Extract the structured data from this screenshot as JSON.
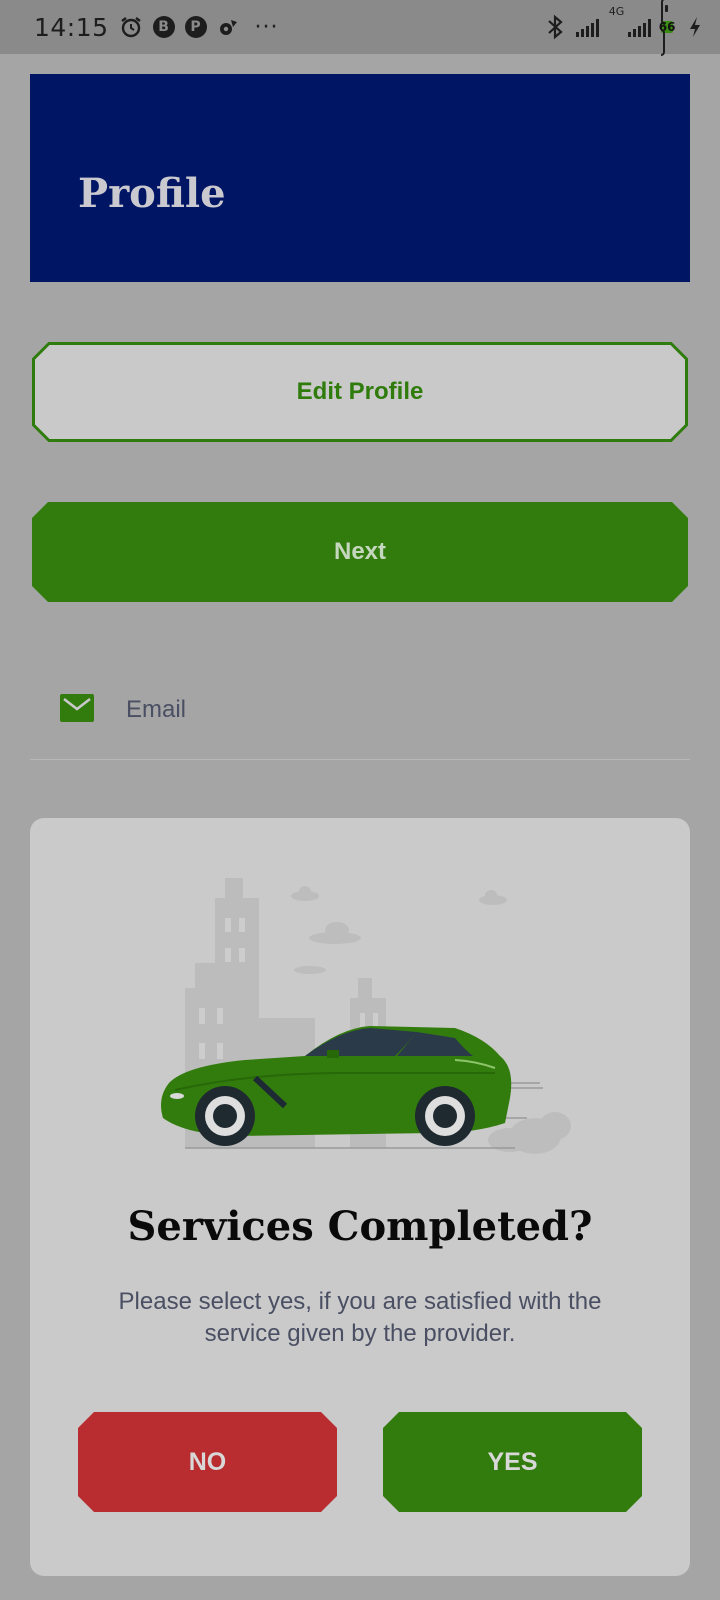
{
  "status_bar": {
    "time": "14:15",
    "network": "4G",
    "battery": "66",
    "more": "···",
    "icons": [
      "alarm-icon",
      "b-app-icon",
      "p-app-icon",
      "settings-icon",
      "bluetooth-icon",
      "signal-icon",
      "signal-4g-icon",
      "battery-icon",
      "charging-icon"
    ]
  },
  "header": {
    "title": "Profile"
  },
  "actions": {
    "edit_profile": "Edit Profile",
    "next": "Next"
  },
  "email": {
    "label": "Email",
    "icon": "mail-icon"
  },
  "dialog": {
    "title": "Services Completed?",
    "message": "Please select yes, if you are satisfied with the service given by the provider.",
    "no_label": "NO",
    "yes_label": "YES",
    "illustration": "sports-car-illustration"
  },
  "colors": {
    "header_bg": "#001563",
    "primary_green": "#327c0d",
    "danger_red": "#b92c2f",
    "overlay_bg": "#a5a5a5"
  }
}
